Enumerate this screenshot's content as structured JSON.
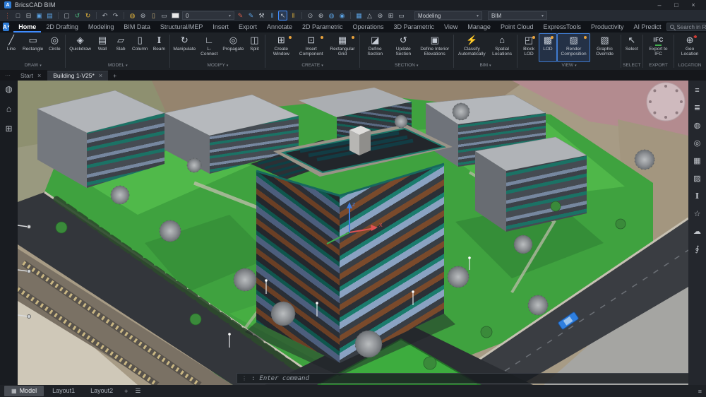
{
  "window": {
    "title": "BricsCAD BIM",
    "app_letter": "A",
    "minimize": "–",
    "maximize": "□",
    "close": "×"
  },
  "ui": {
    "chevron_down": "▾"
  },
  "quick_access": {
    "icons": [
      {
        "name": "doc-status-grip",
        "glyph": "⋮"
      },
      {
        "name": "new-file",
        "glyph": "□"
      },
      {
        "name": "open-file",
        "glyph": "⊟"
      },
      {
        "name": "save",
        "glyph": "▣"
      },
      {
        "name": "save-as",
        "glyph": "▤"
      },
      {
        "name": "print-preview",
        "glyph": "▢"
      },
      {
        "name": "import",
        "glyph": "↺"
      },
      {
        "name": "export",
        "glyph": "↻"
      },
      {
        "name": "undo",
        "glyph": "↶"
      },
      {
        "name": "redo",
        "glyph": "↷"
      },
      {
        "name": "layer-on",
        "glyph": "◍"
      },
      {
        "name": "layer-sun",
        "glyph": "⊛"
      },
      {
        "name": "layer-lock",
        "glyph": "▯"
      },
      {
        "name": "layer-print",
        "glyph": "▭"
      },
      {
        "name": "draw-order",
        "glyph": "✎"
      },
      {
        "name": "annotate-pen",
        "glyph": "✎"
      },
      {
        "name": "workspace-tools",
        "glyph": "⚒"
      },
      {
        "name": "columns-a",
        "glyph": "‖"
      },
      {
        "name": "pick-cursor",
        "glyph": "↖"
      },
      {
        "name": "columns-b",
        "glyph": "‖"
      },
      {
        "name": "orbit",
        "glyph": "⊙"
      },
      {
        "name": "pan",
        "glyph": "⊕"
      },
      {
        "name": "look",
        "glyph": "◍"
      },
      {
        "name": "shade",
        "glyph": "◉"
      },
      {
        "name": "sheets",
        "glyph": "▦"
      },
      {
        "name": "measure",
        "glyph": "△"
      },
      {
        "name": "settings",
        "glyph": "⊛"
      },
      {
        "name": "panels",
        "glyph": "⊞"
      },
      {
        "name": "media",
        "glyph": "▭"
      }
    ],
    "layer_value": "0",
    "workspace": "Modeling",
    "profile": "BIM"
  },
  "ribbon": {
    "tabs": [
      "Home",
      "2D Drafting",
      "Modeling",
      "BIM Data",
      "Structural/MEP",
      "Insert",
      "Export",
      "Annotate",
      "2D Parametric",
      "Operations",
      "3D Parametric",
      "View",
      "Manage",
      "Point Cloud",
      "ExpressTools",
      "Productivity",
      "AI Predict"
    ],
    "active_tab": "Home",
    "search_placeholder": "Search in Ribbon",
    "groups": [
      {
        "label": "DRAW",
        "buttons": [
          {
            "label": "Line",
            "glyph": "╱"
          },
          {
            "label": "Rectangle",
            "glyph": "▭"
          },
          {
            "label": "Circle",
            "glyph": "◎"
          }
        ]
      },
      {
        "label": "MODEL",
        "buttons": [
          {
            "label": "Quickdraw",
            "glyph": "◈"
          },
          {
            "label": "Wall",
            "glyph": "▤"
          },
          {
            "label": "Slab",
            "glyph": "▱"
          },
          {
            "label": "Column",
            "glyph": "▯"
          },
          {
            "label": "Beam",
            "glyph": "I"
          }
        ]
      },
      {
        "label": "MODIFY",
        "buttons": [
          {
            "label": "Manipulate",
            "glyph": "↻"
          },
          {
            "label": "L-Connect",
            "glyph": "∟"
          },
          {
            "label": "Propagate",
            "glyph": "◎"
          },
          {
            "label": "Split",
            "glyph": "◫"
          }
        ]
      },
      {
        "label": "CREATE",
        "buttons": [
          {
            "label": "Create Window",
            "glyph": "⊞"
          },
          {
            "label": "Insert Component",
            "glyph": "⊡"
          },
          {
            "label": "Rectangular Grid",
            "glyph": "▦"
          }
        ]
      },
      {
        "label": "SECTION",
        "buttons": [
          {
            "label": "Define Section",
            "glyph": "◪"
          },
          {
            "label": "Update Section",
            "glyph": "↺"
          },
          {
            "label": "Define Interior Elevations",
            "glyph": "▣"
          }
        ]
      },
      {
        "label": "BIM",
        "buttons": [
          {
            "label": "Classify Automatically",
            "glyph": "⚡"
          },
          {
            "label": "Spatial Locations",
            "glyph": "⌂"
          }
        ]
      },
      {
        "label": "VIEW",
        "buttons": [
          {
            "label": "Block LOD",
            "glyph": "◰"
          },
          {
            "label": "LOD",
            "glyph": "▩"
          },
          {
            "label": "Render Composition",
            "glyph": "▨"
          },
          {
            "label": "Graphic Override",
            "glyph": "▧"
          }
        ]
      },
      {
        "label": "SELECT",
        "buttons": [
          {
            "label": "Select",
            "glyph": "↖"
          }
        ]
      },
      {
        "label": "EXPORT",
        "buttons": [
          {
            "label": "Export to IFC",
            "glyph": "IFC"
          }
        ]
      },
      {
        "label": "LOCATION",
        "buttons": [
          {
            "label": "Geo Location",
            "glyph": "⊕"
          }
        ]
      }
    ]
  },
  "documents": {
    "grip": "⋯",
    "tabs": [
      {
        "label": "Start",
        "active": false
      },
      {
        "label": "Building 1-V25*",
        "active": true
      }
    ],
    "close_glyph": "×",
    "add_glyph": "+"
  },
  "left_dock": {
    "icons": [
      {
        "name": "tips",
        "glyph": "◍"
      },
      {
        "name": "home",
        "glyph": "⌂"
      },
      {
        "name": "structure-browser",
        "glyph": "⊞"
      }
    ]
  },
  "right_dock": {
    "icons": [
      {
        "name": "properties",
        "glyph": "≡"
      },
      {
        "name": "layers",
        "glyph": "≣"
      },
      {
        "name": "light-sources",
        "glyph": "◍"
      },
      {
        "name": "propagate",
        "glyph": "◎"
      },
      {
        "name": "materials",
        "glyph": "▦"
      },
      {
        "name": "render-presets",
        "glyph": "▨"
      },
      {
        "name": "text-styles",
        "glyph": "I"
      },
      {
        "name": "favorites",
        "glyph": "☆"
      },
      {
        "name": "cloud",
        "glyph": "☁"
      },
      {
        "name": "attachments",
        "glyph": "∮"
      }
    ]
  },
  "command_line": {
    "grip": "⋮",
    "prompt": ":",
    "text": "Enter command",
    "expand": "▴"
  },
  "status_bar": {
    "model_tab": "Model",
    "model_icon": "▦",
    "layout_tabs": [
      "Layout1",
      "Layout2"
    ],
    "add_glyph": "+",
    "list_glyph": "☰",
    "settings_glyph": "≡"
  },
  "viewport": {
    "ucs": {
      "x_label": "X",
      "z_label": "Z"
    }
  },
  "colors": {
    "accent_blue": "#3f8cff",
    "app_blue": "#2e7cd6",
    "lawn_green": "#3fa23f",
    "teal_band": "#1a7c6d",
    "wood_brown": "#6a3f25",
    "road_dark": "#33363b",
    "building_grey": "#b4b7bb",
    "aerial_tan": "#a79b85"
  }
}
